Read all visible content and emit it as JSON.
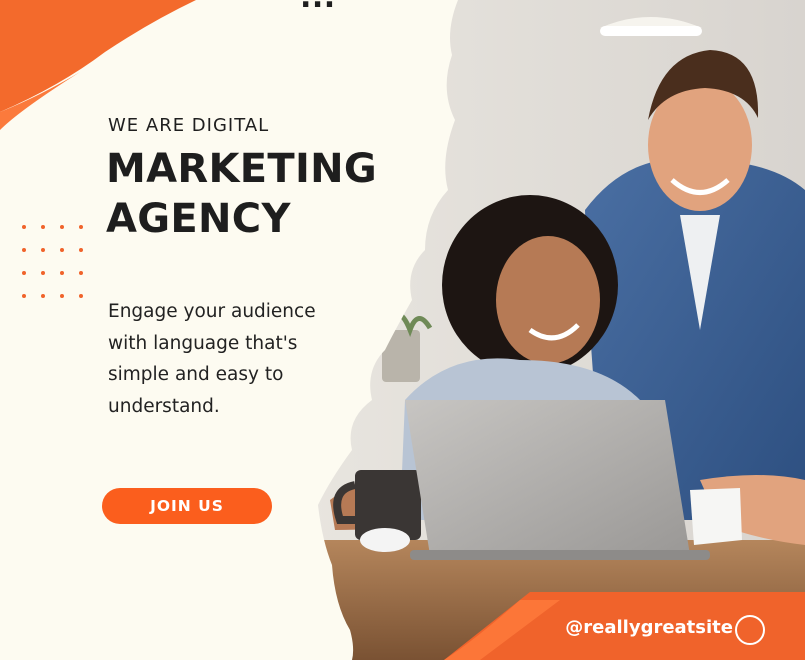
{
  "brand": {
    "accent": "#fb5e1d",
    "accent_dark": "#f0632b",
    "paper": "#fdfbf1",
    "ink": "#1e1e1e"
  },
  "hero": {
    "top_cut_text": "...",
    "eyebrow": "WE ARE DIGITAL",
    "headline_line1": "MARKETING",
    "headline_line2": "AGENCY",
    "body": "Engage your audience with language that's simple and easy to understand.",
    "cta_label": "JOIN US"
  },
  "footer": {
    "handle": "@reallygreatsite",
    "icon": "circle-icon"
  },
  "image": {
    "subject": "photo-of-two-people-at-laptop"
  }
}
